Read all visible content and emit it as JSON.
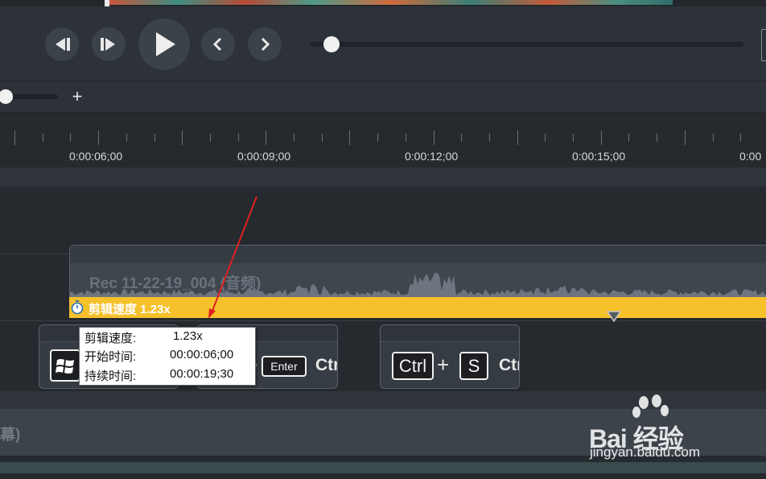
{
  "player": {
    "buttons": [
      "prev-frame",
      "next-frame",
      "play",
      "prev",
      "next"
    ]
  },
  "zoom": {
    "plus_label": "+"
  },
  "ruler": {
    "labels": [
      "0:00:06;00",
      "0:00:09;00",
      "0:00:12;00",
      "0:00:15;00",
      "0:00"
    ]
  },
  "audio_clip": {
    "title": "Rec 11-22-19_004 (音频)"
  },
  "speed_bar": {
    "label": "剪辑速度 1.23x",
    "color": "#f6c12b"
  },
  "caption_clips": [
    {
      "keys": [
        "Win-logo"
      ]
    },
    {
      "keys": [
        "+",
        "Enter"
      ],
      "trailing": "Ctrl"
    },
    {
      "keys": [
        "Ctrl",
        "+",
        "S"
      ],
      "trailing": "Ctrl"
    }
  ],
  "tooltip": {
    "rows": [
      {
        "key": "剪辑速度:",
        "value": "1.23x"
      },
      {
        "key": "开始时间:",
        "value": "00:00:06;00"
      },
      {
        "key": "持续时间:",
        "value": "00:00:19;30"
      }
    ]
  },
  "bottom_track": {
    "label": "幕)"
  },
  "watermark": {
    "text": "Bai 经验",
    "url": "jingyan.baidu.com"
  },
  "annotation": {
    "arrow_color": "#e02020"
  }
}
